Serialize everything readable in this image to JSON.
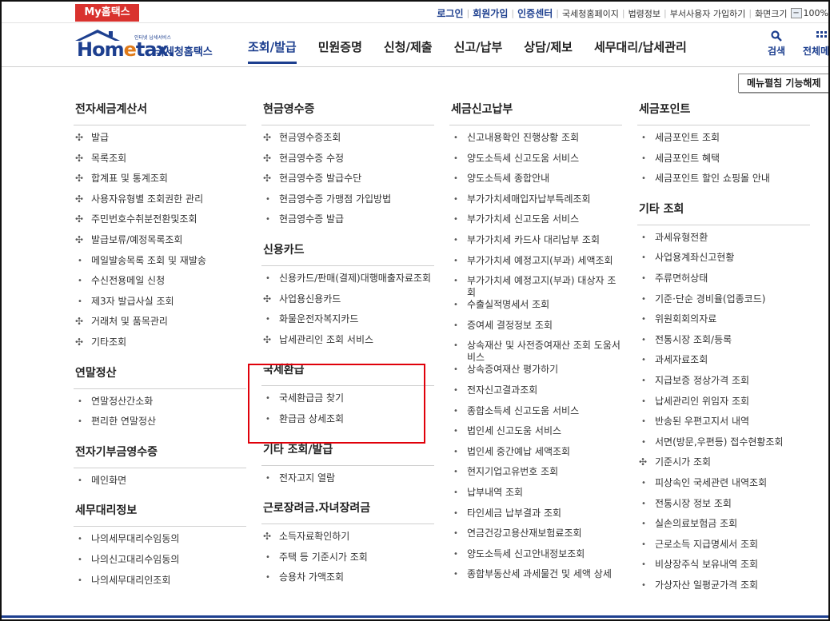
{
  "topbar": {
    "my_tab": "My홈택스",
    "links_strong": [
      "로그인",
      "회원가입",
      "인증센터"
    ],
    "links_plain": [
      "국세청홈페이지",
      "법령정보",
      "부서사용자 가입하기",
      "화면크기"
    ],
    "zoom_value": "100%",
    "zoom_minus": "−"
  },
  "header": {
    "logo_brand": "Hom",
    "logo_brand_e": "e",
    "logo_brand_rest": "tax.",
    "logo_small": "인터넷 납세서비스",
    "logo_kor": "국세청홈택스",
    "gnb": [
      "조회/발급",
      "민원증명",
      "신청/제출",
      "신고/납부",
      "상담/제보",
      "세무대리/납세관리"
    ],
    "search_label": "검색",
    "all_label": "전체메"
  },
  "collapse_button": "메뉴펼침 기능해제",
  "columns": [
    {
      "sections": [
        {
          "title": "전자세금계산서",
          "items": [
            {
              "m": "plus",
              "t": "발급"
            },
            {
              "m": "plus",
              "t": "목록조회"
            },
            {
              "m": "plus",
              "t": "합계표 및 통계조회"
            },
            {
              "m": "plus",
              "t": "사용자유형별 조회권한 관리"
            },
            {
              "m": "plus",
              "t": "주민번호수취분전환및조회"
            },
            {
              "m": "plus",
              "t": "발급보류/예정목록조회"
            },
            {
              "m": "dot",
              "t": "메일발송목록 조회 및 재발송"
            },
            {
              "m": "dot",
              "t": "수신전용메일 신청"
            },
            {
              "m": "dot",
              "t": "제3자 발급사실 조회"
            },
            {
              "m": "plus",
              "t": "거래처 및 품목관리"
            },
            {
              "m": "plus",
              "t": "기타조회"
            }
          ]
        },
        {
          "title": "연말정산",
          "items": [
            {
              "m": "dot",
              "t": "연말정산간소화"
            },
            {
              "m": "dot",
              "t": "편리한 연말정산"
            }
          ]
        },
        {
          "title": "전자기부금영수증",
          "items": [
            {
              "m": "dot",
              "t": "메인화면"
            }
          ]
        },
        {
          "title": "세무대리정보",
          "items": [
            {
              "m": "dot",
              "t": "나의세무대리수임동의"
            },
            {
              "m": "dot",
              "t": "나의신고대리수임동의"
            },
            {
              "m": "dot",
              "t": "나의세무대리인조회"
            }
          ]
        }
      ]
    },
    {
      "sections": [
        {
          "title": "현금영수증",
          "items": [
            {
              "m": "plus",
              "t": "현금영수증조회"
            },
            {
              "m": "plus",
              "t": "현금영수증 수정"
            },
            {
              "m": "plus",
              "t": "현금영수증 발급수단"
            },
            {
              "m": "dot",
              "t": "현금영수증 가맹점 가입방법"
            },
            {
              "m": "dot",
              "t": "현금영수증 발급"
            }
          ]
        },
        {
          "title": "신용카드",
          "items": [
            {
              "m": "dot",
              "t": "신용카드/판매(결제)대행매출자료조회"
            },
            {
              "m": "plus",
              "t": "사업용신용카드"
            },
            {
              "m": "dot",
              "t": "화물운전자복지카드"
            },
            {
              "m": "plus",
              "t": "납세관리인 조회 서비스"
            }
          ]
        },
        {
          "title": "국세환급",
          "items": [
            {
              "m": "dot",
              "t": "국세환급금 찾기"
            },
            {
              "m": "dot",
              "t": "환급금 상세조회"
            }
          ]
        },
        {
          "title": "기타 조회/발급",
          "items": [
            {
              "m": "dot",
              "t": "전자고지 열람"
            }
          ]
        },
        {
          "title": "근로장려금.자녀장려금",
          "items": [
            {
              "m": "plus",
              "t": "소득자료확인하기"
            },
            {
              "m": "dot",
              "t": "주택 등 기준시가 조회"
            },
            {
              "m": "dot",
              "t": "승용차 가액조회"
            }
          ]
        }
      ]
    },
    {
      "sections": [
        {
          "title": "세금신고납부",
          "items": [
            {
              "m": "dot",
              "t": "신고내용확인 진행상황 조회"
            },
            {
              "m": "dot",
              "t": "양도소득세 신고도움 서비스"
            },
            {
              "m": "dot",
              "t": "양도소득세 종합안내"
            },
            {
              "m": "dot",
              "t": "부가가치세매입자납부특례조회"
            },
            {
              "m": "dot",
              "t": "부가가치세 신고도움 서비스"
            },
            {
              "m": "dot",
              "t": "부가가치세 카드사 대리납부 조회"
            },
            {
              "m": "dot",
              "t": "부가가치세 예정고지(부과) 세액조회"
            },
            {
              "m": "dot",
              "t": "부가가치세 예정고지(부과) 대상자 조회"
            },
            {
              "m": "dot",
              "t": "수출실적명세서 조회"
            },
            {
              "m": "dot",
              "t": "증여세 결정정보 조회"
            },
            {
              "m": "dot",
              "t": "상속재산 및 사전증여재산 조회 도움서비스"
            },
            {
              "m": "dot",
              "t": "상속증여재산 평가하기"
            },
            {
              "m": "dot",
              "t": "전자신고결과조회"
            },
            {
              "m": "dot",
              "t": "종합소득세 신고도움 서비스"
            },
            {
              "m": "dot",
              "t": "법인세 신고도움 서비스"
            },
            {
              "m": "dot",
              "t": "법인세 중간예납 세액조회"
            },
            {
              "m": "dot",
              "t": "현지기업고유번호 조회"
            },
            {
              "m": "dot",
              "t": "납부내역 조회"
            },
            {
              "m": "dot",
              "t": "타인세금 납부결과 조회"
            },
            {
              "m": "dot",
              "t": "연금건강고용산재보험료조회"
            },
            {
              "m": "dot",
              "t": "양도소득세 신고안내정보조회"
            },
            {
              "m": "dot",
              "t": "종합부동산세 과세물건 및 세액 상세"
            }
          ]
        }
      ]
    },
    {
      "sections": [
        {
          "title": "세금포인트",
          "items": [
            {
              "m": "dot",
              "t": "세금포인트 조회"
            },
            {
              "m": "dot",
              "t": "세금포인트 혜택"
            },
            {
              "m": "dot",
              "t": "세금포인트 할인 쇼핑몰 안내"
            }
          ]
        },
        {
          "title": "기타 조회",
          "items": [
            {
              "m": "dot",
              "t": "과세유형전환"
            },
            {
              "m": "dot",
              "t": "사업용계좌신고현황"
            },
            {
              "m": "dot",
              "t": "주류면허상태"
            },
            {
              "m": "dot",
              "t": "기준·단순 경비율(업종코드)"
            },
            {
              "m": "dot",
              "t": "위원회회의자료"
            },
            {
              "m": "dot",
              "t": "전통시장 조회/등록"
            },
            {
              "m": "dot",
              "t": "과세자료조회"
            },
            {
              "m": "dot",
              "t": "지급보증 정상가격 조회"
            },
            {
              "m": "dot",
              "t": "납세관리인 위임자 조회"
            },
            {
              "m": "dot",
              "t": "반송된 우편고지서 내역"
            },
            {
              "m": "dot",
              "t": "서면(방문,우편등) 접수현황조회"
            },
            {
              "m": "plus",
              "t": "기준시가 조회"
            },
            {
              "m": "dot",
              "t": "피상속인 국세관련 내역조회"
            },
            {
              "m": "dot",
              "t": "전통시장 정보 조회"
            },
            {
              "m": "dot",
              "t": "실손의료보험금 조회"
            },
            {
              "m": "dot",
              "t": "근로소득 지급명세서 조회"
            },
            {
              "m": "dot",
              "t": "비상장주식 보유내역 조회"
            },
            {
              "m": "dot",
              "t": "가상자산 일평균가격 조회"
            }
          ]
        }
      ]
    }
  ],
  "icons": {
    "plus": "✣",
    "dot": "•",
    "search": "search-icon",
    "grid": "grid-icon"
  },
  "colors": {
    "brand": "#1d3f8f",
    "accent": "#d9322e",
    "highlight": "#e0000a"
  }
}
